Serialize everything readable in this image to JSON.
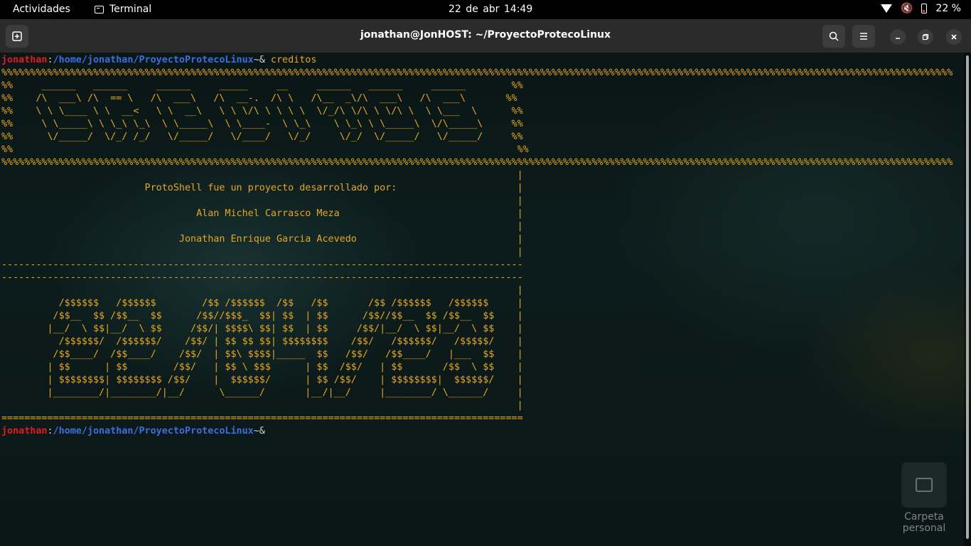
{
  "topbar": {
    "activities": "Actividades",
    "app_name": "Terminal",
    "clock": "22 de abr  14:49",
    "battery": "22 %"
  },
  "window": {
    "title": "jonathan@JonHOST: ~/ProyectoProtecoLinux"
  },
  "terminal": {
    "prompt_user": "jonathan",
    "prompt_sep": ":",
    "prompt_path": "/home/jonathan/ProyectoProtecoLinux",
    "prompt_symbol": "~& ",
    "command": "creditos",
    "output_lines": [
      "%%%%%%%%%%%%%%%%%%%%%%%%%%%%%%%%%%%%%%%%%%%%%%%%%%%%%%%%%%%%%%%%%%%%%%%%%%%%%%%%%%%%%%%%%%%%%%%%%%%%%%%%%%%%%%%%%%%%%%%%%%%%%%%%%%%%%%%%%%%%%%%%%%%%%%%%%%%%%%%%%%%%%%",
      "%%     ______   ______     ______     _____     __     ______   ______     ______        %%",
      "%%    /\\  ___\\ /\\  == \\   /\\  ___\\   /\\  __-.  /\\ \\   /\\__  _\\/\\  ___\\   /\\  ___\\       %%",
      "%%    \\ \\ \\____ \\ \\  __<   \\ \\  __\\   \\ \\ \\/\\ \\ \\ \\ \\  \\/_/\\ \\/\\ \\ \\/\\ \\  \\ \\___  \\      %%",
      "%%     \\ \\_____\\ \\ \\_\\ \\_\\  \\ \\_____\\  \\ \\____-  \\ \\_\\    \\ \\_\\ \\ \\_____\\  \\/\\_____\\     %%",
      "%%      \\/_____/  \\/_/ /_/   \\/_____/   \\/____/   \\/_/     \\/_/  \\/_____/   \\/_____/     %%",
      "%%                                                                                        %%",
      "%%%%%%%%%%%%%%%%%%%%%%%%%%%%%%%%%%%%%%%%%%%%%%%%%%%%%%%%%%%%%%%%%%%%%%%%%%%%%%%%%%%%%%%%%%%%%%%%%%%%%%%%%%%%%%%%%%%%%%%%%%%%%%%%%%%%%%%%%%%%%%%%%%%%%%%%%%%%%%%%%%%%%%",
      "                                                                                          |",
      "                         ProtoShell fue un proyecto desarrollado por:                     |",
      "                                                                                          |",
      "                                  Alan Michel Carrasco Meza                               |",
      "                                                                                          |",
      "                               Jonathan Enrique Garcia Acevedo                            |",
      "                                                                                          |",
      "-------------------------------------------------------------------------------------------",
      "-------------------------------------------------------------------------------------------",
      "                                                                                          |",
      "          /$$$$$$   /$$$$$$        /$$ /$$$$$$  /$$   /$$       /$$ /$$$$$$   /$$$$$$     |",
      "         /$$__  $$ /$$__  $$      /$$//$$$_  $$| $$  | $$      /$$//$$__  $$ /$$__  $$    |",
      "        |__/  \\ $$|__/  \\ $$     /$$/| $$$$\\ $$| $$  | $$     /$$/|__/  \\ $$|__/  \\ $$    |",
      "          /$$$$$$/  /$$$$$$/    /$$/ | $$ $$ $$| $$$$$$$$    /$$/   /$$$$$$/   /$$$$$/    |",
      "         /$$____/  /$$____/    /$$/  | $$\\ $$$$|_____  $$   /$$/   /$$____/   |___  $$    |",
      "        | $$      | $$        /$$/   | $$ \\ $$$      | $$  /$$/   | $$       /$$  \\ $$    |",
      "        | $$$$$$$$| $$$$$$$$ /$$/    |  $$$$$$/      | $$ /$$/    | $$$$$$$$|  $$$$$$/    |",
      "        |________/|________/|__/      \\______/       |__/|__/     |________/ \\______/     |",
      "                                                                                          |",
      "==========================================================================================="
    ]
  },
  "desktop": {
    "folder_label": "Carpeta personal"
  }
}
